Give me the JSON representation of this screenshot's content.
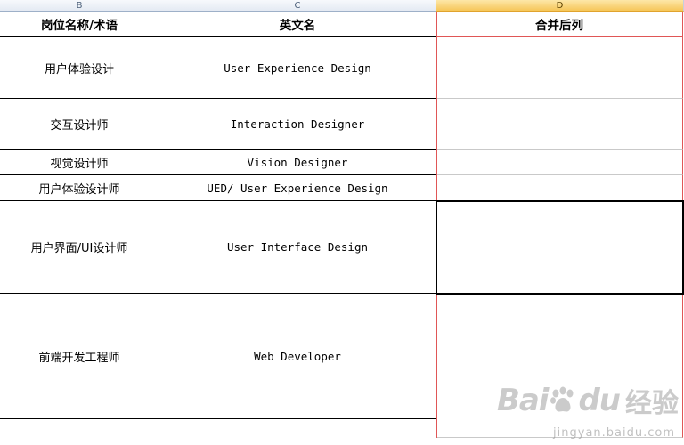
{
  "columns": [
    "B",
    "C",
    "D"
  ],
  "header": {
    "b": "岗位名称/术语",
    "c": "英文名",
    "d": "合并后列"
  },
  "rows": [
    {
      "zh": "用户体验设计",
      "en": "User Experience Design"
    },
    {
      "zh": "交互设计师",
      "en": "Interaction Designer"
    },
    {
      "zh": "视觉设计师",
      "en": "Vision Designer"
    },
    {
      "zh": "用户体验设计师",
      "en": "UED/ User Experience Design"
    },
    {
      "zh": "用户界面/UI设计师",
      "en": "User Interface Design"
    },
    {
      "zh": "前端开发工程师",
      "en": "Web Developer"
    }
  ],
  "watermark": {
    "brand": "Bai",
    "brand_mark": "du",
    "product": "经验",
    "url": "jingyan.baidu.com"
  }
}
